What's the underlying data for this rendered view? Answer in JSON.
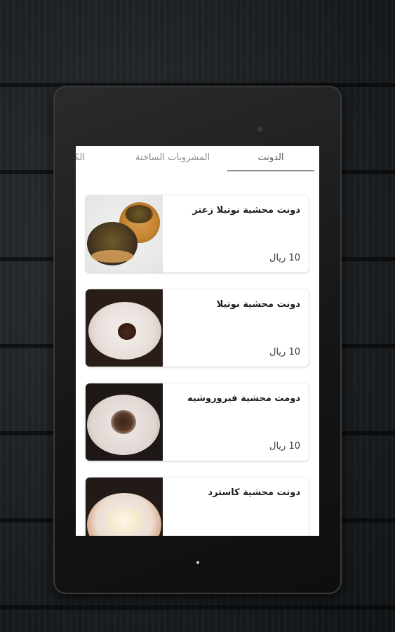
{
  "tabs": [
    {
      "label": "الدونت",
      "active": true
    },
    {
      "label": "المشروبات الساخنة",
      "active": false
    },
    {
      "label": "الكرو",
      "active": false
    }
  ],
  "products": [
    {
      "title": "دونت محشية نوتيلا زعتر",
      "price": "10 ريال",
      "image": "donut-zaatar-image"
    },
    {
      "title": "دونت محشية نوتيلا",
      "price": "10 ريال",
      "image": "donut-nutella-image"
    },
    {
      "title": "دومت محشية فيروروشيه",
      "price": "10 ريال",
      "image": "donut-ferrero-image"
    },
    {
      "title": "دونت محشية كاسترد",
      "price": "",
      "image": "donut-custard-image"
    }
  ],
  "colors": {
    "screen_bg": "#ffffff",
    "tab_indicator": "#8c8c8c",
    "tablet_body": "#161616"
  }
}
